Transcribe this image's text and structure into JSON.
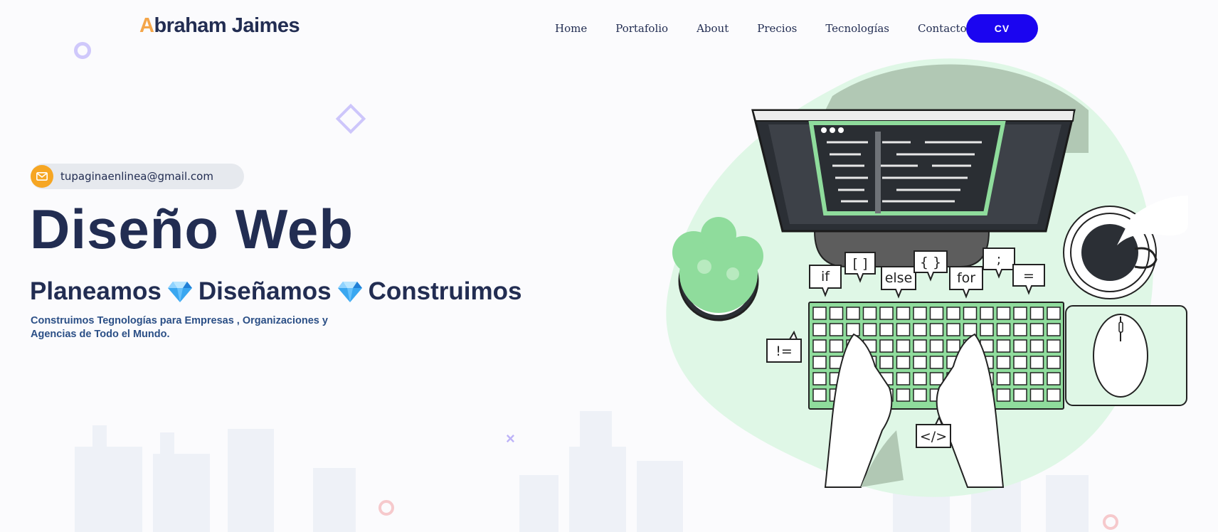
{
  "header": {
    "logo": {
      "first_letter": "A",
      "rest": "braham Jaimes"
    },
    "nav": [
      "Home",
      "Portafolio",
      "About",
      "Precios",
      "Tecnologías",
      "Contacto"
    ],
    "cv_label": "CV"
  },
  "hero": {
    "email": "tupaginaenlinea@gmail.com",
    "title": "Diseño Web",
    "tagline": [
      "Planeamos",
      "Diseñamos",
      "Construimos"
    ],
    "subtitle": "Construimos Tegnologías para Empresas , Organizaciones y Agencias de Todo el Mundo."
  },
  "illustration": {
    "code_bubbles": [
      "if",
      "[ ]",
      "else",
      "{ }",
      "for",
      ";",
      "=",
      "!=",
      "</>"
    ]
  },
  "colors": {
    "brand_dark": "#222d52",
    "accent_orange": "#f4a64a",
    "cv_button": "#1b05f0",
    "illustration_green": "#8fdc9c"
  },
  "icons": [
    "mail-icon",
    "gem-icon"
  ]
}
